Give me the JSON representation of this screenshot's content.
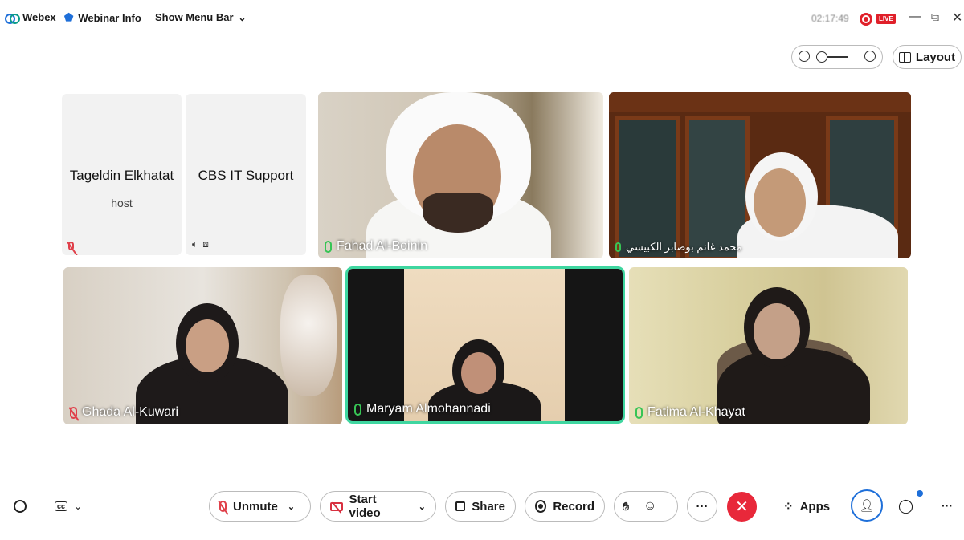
{
  "topbar": {
    "app_name": "Webex",
    "webinar_info": "Webinar Info",
    "show_menu_bar": "Show Menu Bar",
    "timer": "02:17:49",
    "live_badge": "LIVE"
  },
  "view_controls": {
    "layout_label": "Layout"
  },
  "participants": [
    {
      "name": "Tageldin Elkhatat",
      "role": "host",
      "video": false,
      "muted": true
    },
    {
      "name": "CBS IT Support",
      "role": "",
      "video": false,
      "muted": false
    },
    {
      "name": "Fahad Al-Boinin",
      "video": true,
      "muted": false
    },
    {
      "name": "محمد غانم بوصابر الكبيسي",
      "video": true,
      "muted": false
    },
    {
      "name": "Ghada Al-Kuwari",
      "video": true,
      "muted": true
    },
    {
      "name": "Maryam Almohannadi",
      "video": true,
      "muted": false,
      "active_speaker": true
    },
    {
      "name": "Fatima Al-Khayat",
      "video": true,
      "muted": false
    }
  ],
  "controls": {
    "unmute": "Unmute",
    "start_video": "Start video",
    "share": "Share",
    "record": "Record",
    "apps": "Apps",
    "more": "···",
    "end": "✕"
  },
  "colors": {
    "accent": "#1e6fd9",
    "end_call": "#e8283a",
    "active_outline": "#3fd6a0",
    "mic_on": "#37c455",
    "mic_off": "#e0404a"
  }
}
